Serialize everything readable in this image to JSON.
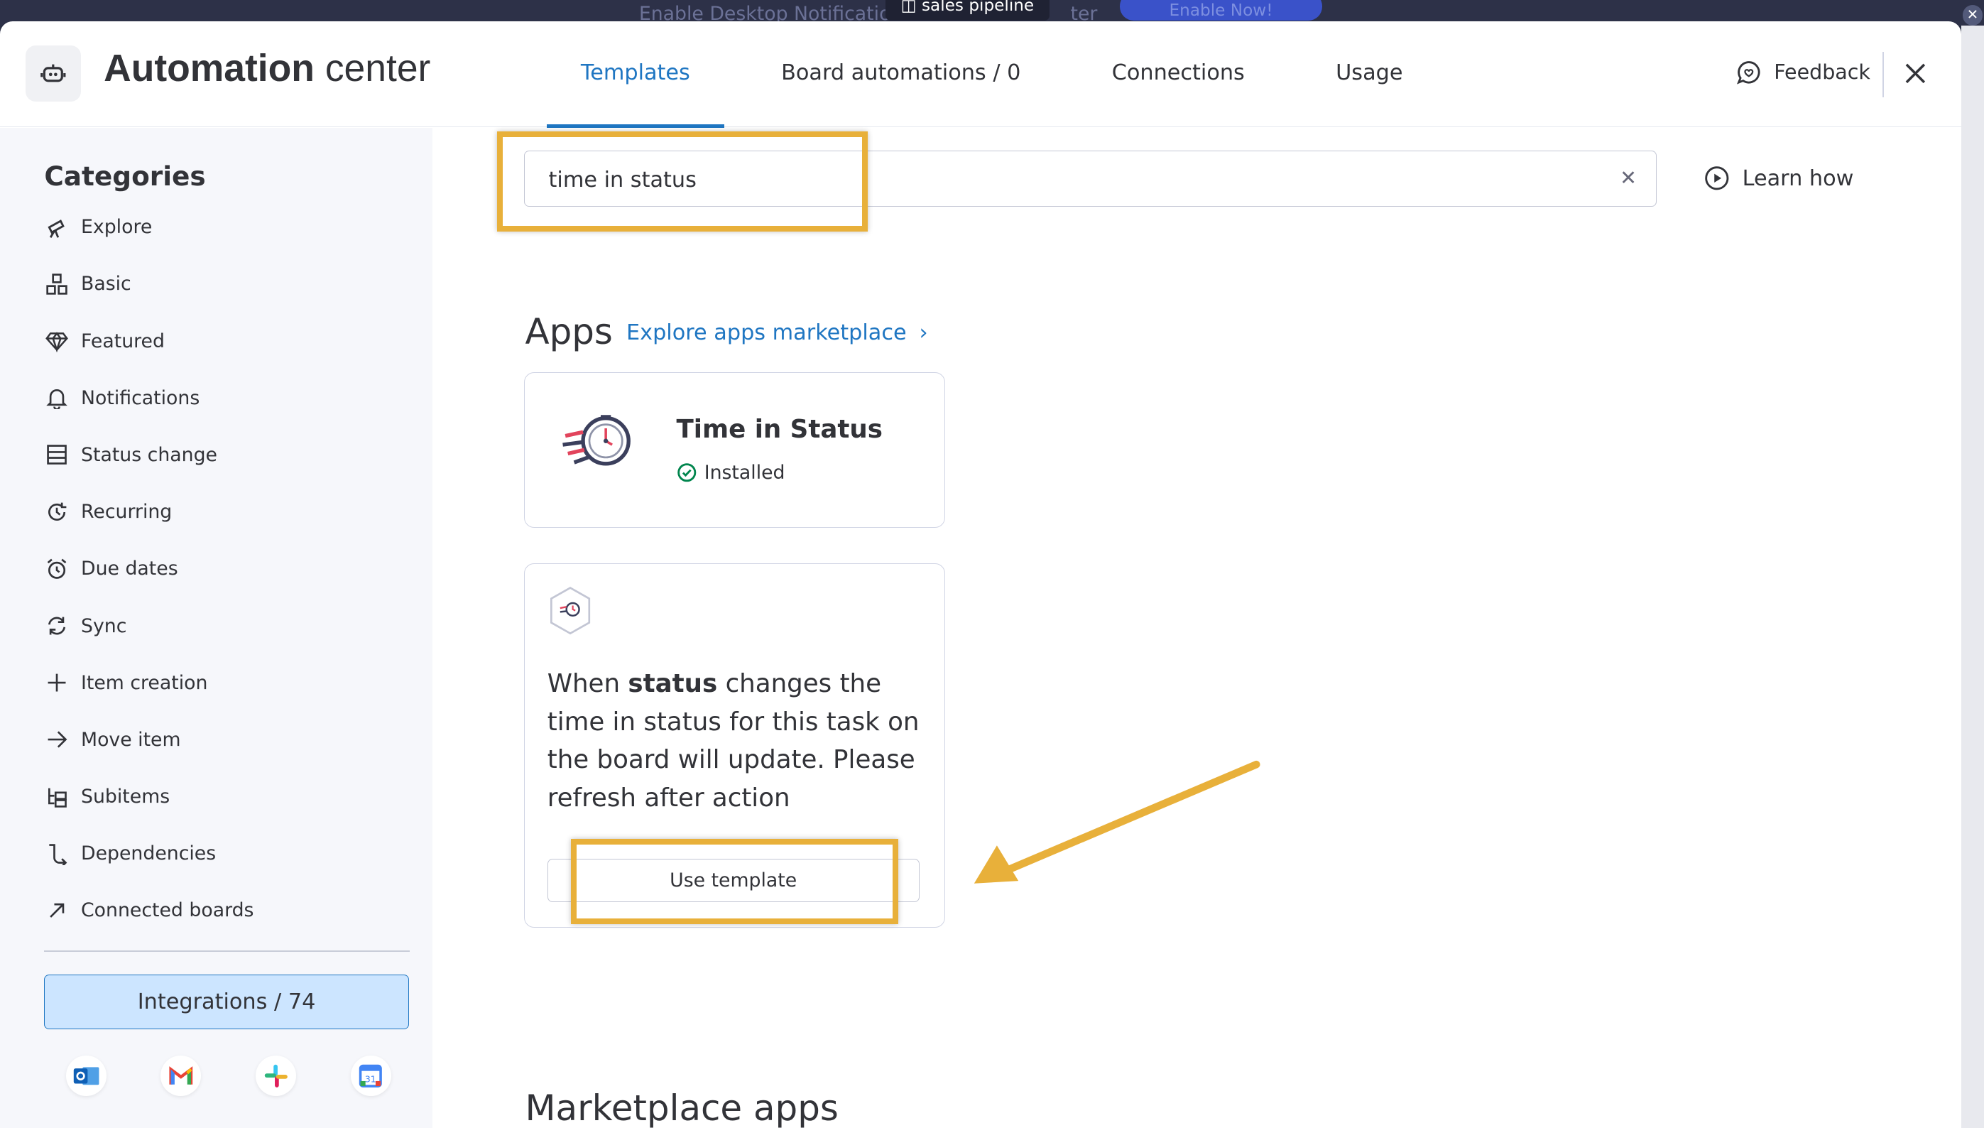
{
  "background": {
    "notification_text": "Enable Desktop Notificatio",
    "notification_tail": "ter",
    "board_pill": "sales pipeline",
    "enable_button": "Enable Now!"
  },
  "header": {
    "title_bold": "Automation",
    "title_rest": "center",
    "tabs": [
      {
        "label": "Templates",
        "active": true
      },
      {
        "label": "Board automations / 0",
        "active": false
      },
      {
        "label": "Connections",
        "active": false
      },
      {
        "label": "Usage",
        "active": false
      }
    ],
    "feedback_label": "Feedback"
  },
  "sidebar": {
    "title": "Categories",
    "items": [
      {
        "label": "Explore",
        "icon": "telescope-icon"
      },
      {
        "label": "Basic",
        "icon": "blocks-icon"
      },
      {
        "label": "Featured",
        "icon": "diamond-icon"
      },
      {
        "label": "Notifications",
        "icon": "bell-icon"
      },
      {
        "label": "Status change",
        "icon": "status-icon"
      },
      {
        "label": "Recurring",
        "icon": "recurring-icon"
      },
      {
        "label": "Due dates",
        "icon": "alarm-icon"
      },
      {
        "label": "Sync",
        "icon": "sync-icon"
      },
      {
        "label": "Item creation",
        "icon": "plus-icon"
      },
      {
        "label": "Move item",
        "icon": "arrow-right-icon"
      },
      {
        "label": "Subitems",
        "icon": "subitems-icon"
      },
      {
        "label": "Dependencies",
        "icon": "dependency-icon"
      },
      {
        "label": "Connected boards",
        "icon": "connect-icon"
      }
    ],
    "integrations_label": "Integrations / 74",
    "integration_icons": [
      "outlook-icon",
      "gmail-icon",
      "slack-icon",
      "google-calendar-icon"
    ]
  },
  "search": {
    "value": "time in status",
    "learn_label": "Learn how"
  },
  "apps": {
    "heading": "Apps",
    "explore_link": "Explore apps marketplace",
    "app_name": "Time in Status",
    "app_status": "Installed"
  },
  "template": {
    "text_before": "When ",
    "text_bold": "status",
    "text_after": " changes the time in status for this task on the board will update. Please refresh after action",
    "button_label": "Use template"
  },
  "marketplace": {
    "heading": "Marketplace apps"
  },
  "colors": {
    "accent": "#1f76c2",
    "highlight": "#e8b03a",
    "integrations_bg": "#cce5ff",
    "installed_check": "#00854d"
  }
}
